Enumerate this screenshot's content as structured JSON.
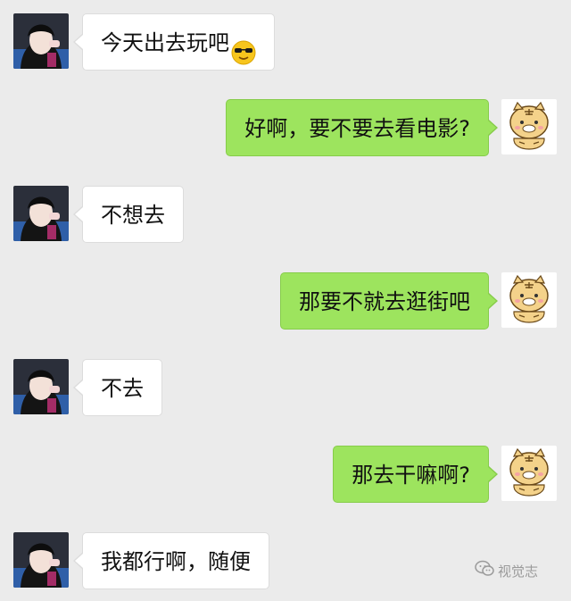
{
  "messages": [
    {
      "side": "left",
      "text": "今天出去玩吧",
      "emoji": "sunglasses-smile-emoji"
    },
    {
      "side": "right",
      "text": "好啊，要不要去看电影?"
    },
    {
      "side": "left",
      "text": "不想去"
    },
    {
      "side": "right",
      "text": "那要不就去逛街吧"
    },
    {
      "side": "left",
      "text": "不去"
    },
    {
      "side": "right",
      "text": "那去干嘛啊?"
    },
    {
      "side": "left",
      "text": "我都行啊，随便"
    }
  ],
  "avatars": {
    "left": "girl-avatar",
    "right": "tiger-cartoon-avatar"
  },
  "watermark": {
    "text": "视觉志",
    "icon": "wechat-official-account-icon"
  },
  "colors": {
    "background": "#ebebeb",
    "bubble_incoming": "#ffffff",
    "bubble_outgoing": "#9de45e"
  }
}
